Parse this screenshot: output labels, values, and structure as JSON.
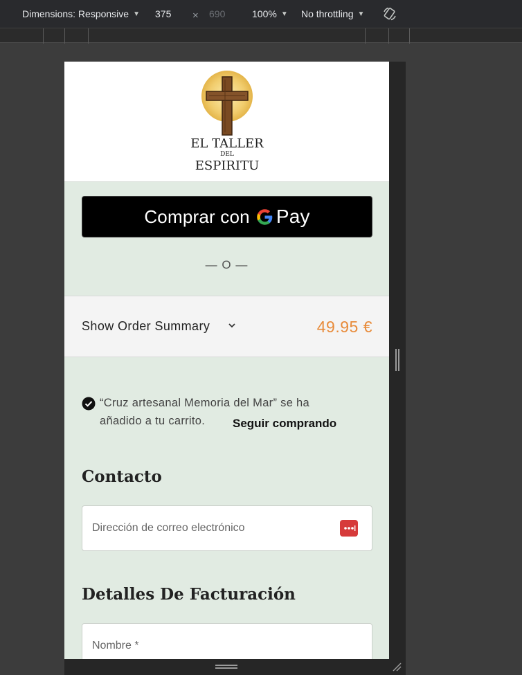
{
  "devtools": {
    "dimensions_label": "Dimensions: Responsive",
    "width": "375",
    "times": "×",
    "height": "690",
    "zoom": "100%",
    "throttling": "No throttling",
    "caret": "▼",
    "rotate_icon": "rotate-icon"
  },
  "header": {
    "logo_line1": "EL TALLER",
    "logo_line2": "DEL",
    "logo_line3": "ESPIRITU"
  },
  "express_checkout": {
    "button_prefix": "Comprar con",
    "button_pay": "Pay",
    "separator": "— O —"
  },
  "order_summary": {
    "label": "Show Order Summary",
    "total": "49.95 €"
  },
  "notice": {
    "message": "“Cruz artesanal Memoria del Mar” se ha añadido a tu carrito.",
    "continue_link": "Seguir comprando"
  },
  "contact": {
    "title": "Contacto",
    "email_placeholder": "Dirección de correo electrónico"
  },
  "billing": {
    "title": "Detalles De Facturación",
    "name_placeholder": "Nombre *"
  },
  "colors": {
    "page_bg": "#e1ebe2",
    "accent_price": "#e88b3a",
    "password_icon": "#d63a3a"
  }
}
